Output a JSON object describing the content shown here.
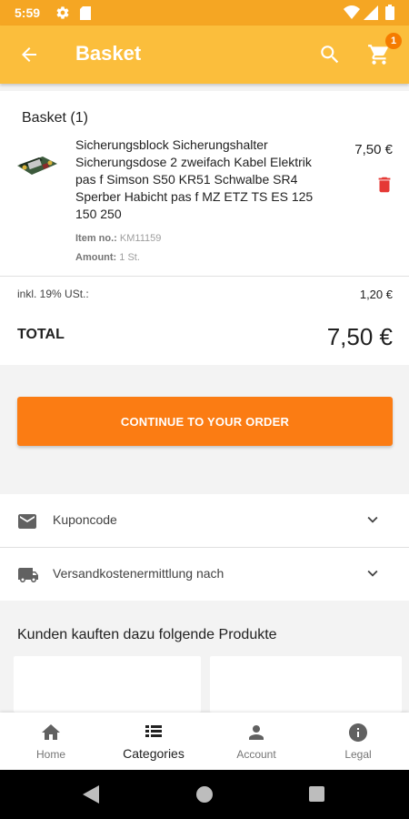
{
  "status_bar": {
    "time": "5:59"
  },
  "app_bar": {
    "title": "Basket",
    "cart_count": "1"
  },
  "basket": {
    "heading": "Basket (1)",
    "item": {
      "name": "Sicherungsblock Sicherungshalter Sicherungsdose 2 zweifach Kabel Elektrik pas f Simson S50 KR51 Schwalbe SR4 Sperber Habicht pas f MZ ETZ TS ES 125 150 250",
      "price": "7,50 €",
      "item_no_label": "Item no.:",
      "item_no_value": "KM11159",
      "amount_label": "Amount:",
      "amount_value": "1 St."
    },
    "tax_label": "inkl. 19% USt.:",
    "tax_value": "1,20 €",
    "total_label": "TOTAL",
    "total_value": "7,50 €"
  },
  "actions": {
    "continue_label": "CONTINUE TO YOUR ORDER"
  },
  "accordions": [
    {
      "label": "Kuponcode",
      "icon": "mail-icon"
    },
    {
      "label": "Versandkostenermittlung nach",
      "icon": "truck-icon"
    }
  ],
  "related": {
    "title": "Kunden kauften dazu folgende Produkte"
  },
  "bottom_nav": [
    {
      "label": "Home",
      "icon": "home-icon"
    },
    {
      "label": "Categories",
      "icon": "list-icon"
    },
    {
      "label": "Account",
      "icon": "account-icon"
    },
    {
      "label": "Legal",
      "icon": "info-icon"
    }
  ],
  "colors": {
    "status_bar": "#f5a623",
    "app_bar": "#fbbe3c",
    "accent": "#fb7c13",
    "delete": "#e53935"
  }
}
